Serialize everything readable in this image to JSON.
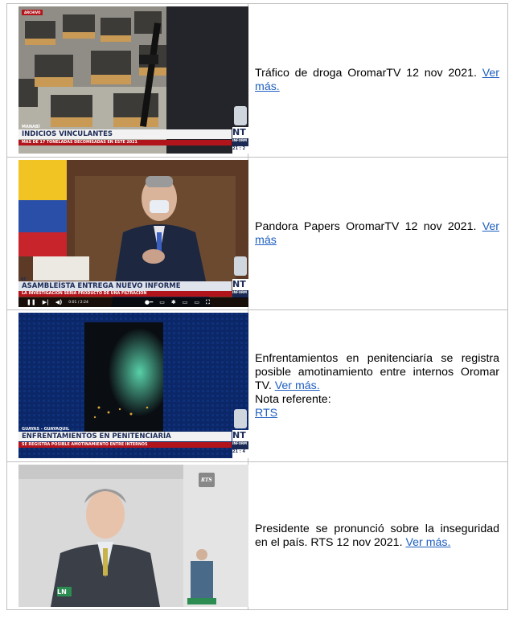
{
  "rows": [
    {
      "video": {
        "tag": "ARCHIVO",
        "location": "MANABÍ",
        "headline": "INDICIOS VINCULANTES",
        "subline": "MÁS DE 17 TONELADAS DECOMISADAS EN ESTE 2021",
        "logo": "NT",
        "logo_sub": "INFORM",
        "clock": "21 : 2"
      },
      "text": "Tráfico de droga OromarTV 12 nov 2021. ",
      "link": "Ver más."
    },
    {
      "video": {
        "location": "EC",
        "headline": "ASAMBLEÍSTA ENTREGA NUEVO INFORME",
        "subline": "LA INVESTIGACIÓN SERÍA PRODUCTO DE UNA FILTRACIÓN",
        "logo": "NT",
        "logo_sub": "INFORM",
        "time": "0:01 / 2:24"
      },
      "text": "Pandora Papers OromarTV 12 nov 2021. ",
      "link": "Ver más"
    },
    {
      "video": {
        "location": "GUAYAS - GUAYAQUIL",
        "headline": "ENFRENTAMIENTOS EN PENITENCIARÍA",
        "subline": "SE REGISTRA POSIBLE AMOTINAMIENTO ENTRE INTERNOS",
        "logo": "NT",
        "logo_sub": "INFORM",
        "clock": "21 : 4"
      },
      "text": "Enfrentamientos en penitenciaría se registra posible amotinamiento entre internos Oromar TV. ",
      "link": "Ver más.",
      "note": "Nota referente:",
      "note_link": "RTS"
    },
    {
      "video": {
        "logo": "RTS",
        "podium": "LN"
      },
      "text": "Presidente se pronunció sobre la inseguridad en el país. RTS 12 nov 2021. ",
      "link": "Ver más."
    }
  ],
  "colors": {
    "link": "#1f5fbf",
    "news_red": "#b2141c",
    "news_navy": "#1b2a55",
    "border": "#bfbfbf"
  }
}
